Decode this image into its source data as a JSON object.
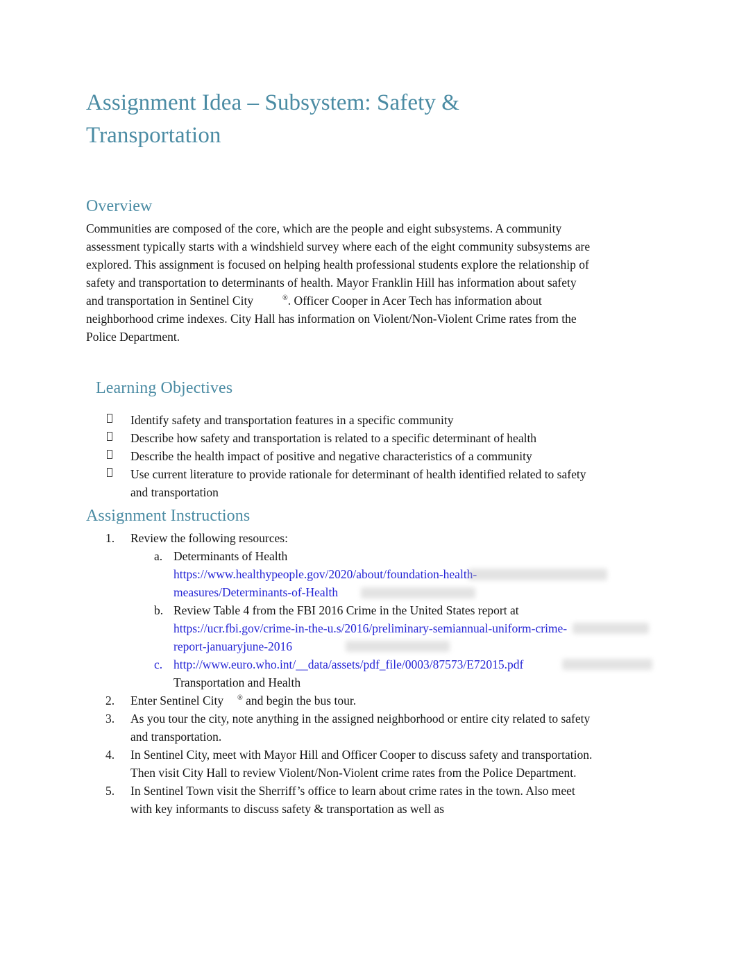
{
  "document": {
    "title": "Assignment Idea – Subsystem: Safety & Transportation",
    "colors": {
      "heading": "#4A8BA3",
      "link": "#2525D5",
      "body": "#151515",
      "page_background": "#ffffff"
    }
  },
  "overview": {
    "heading": "Overview",
    "paragraph_part1": "Communities are composed of the core, which are the people and eight subsystems. A community assessment typically starts with a windshield survey where each of the eight community subsystems are explored. This assignment is focused on helping health professional students explore the relationship of safety and transportation to determinants of health. Mayor Franklin Hill has information about safety and transportation in Sentinel City",
    "registered_mark": "®",
    "paragraph_part2": ". Officer Cooper in Acer Tech has information about neighborhood crime indexes. City Hall has information on Violent/Non-Violent Crime rates from the Police Department."
  },
  "learning_objectives": {
    "heading": "Learning Objectives",
    "bullet_glyph": "tofu-box-bullet",
    "items": [
      "Identify safety and transportation features in a specific community",
      "Describe how safety and transportation is related to a specific determinant of health",
      "Describe the health impact of positive and negative characteristics of a community",
      "Use current literature to provide rationale for determinant of health identified related to safety and transportation"
    ]
  },
  "assignment_instructions": {
    "heading": "Assignment Instructions",
    "items": [
      {
        "marker": "1.",
        "text": "Review the following resources:",
        "subitems": [
          {
            "marker": "a.",
            "text": "Determinants of Health",
            "link": "https://www.healthypeople.gov/2020/about/foundation-health-measures/Determinants-of-Health",
            "marker_is_link": false
          },
          {
            "marker": "b.",
            "text": "Review Table 4 from the FBI 2016 Crime in the United States report at",
            "link": "https://ucr.fbi.gov/crime-in-the-u.s/2016/preliminary-semiannual-uniform-crime-report-januaryjune-2016",
            "marker_is_link": false
          },
          {
            "marker": "c.",
            "link": "http://www.euro.who.int/__data/assets/pdf_file/0003/87573/E72015.pdf",
            "text_after": "Transportation and Health",
            "marker_is_link": true
          }
        ]
      },
      {
        "marker": "2.",
        "text_before_mark": "Enter Sentinel City",
        "registered_mark": "®",
        "text_after_mark": "and begin the bus tour."
      },
      {
        "marker": "3.",
        "text": "As you tour the city, note anything in the assigned neighborhood or entire city related to safety and transportation."
      },
      {
        "marker": "4.",
        "text": "In Sentinel City, meet with Mayor Hill and Officer Cooper to discuss safety and transportation. Then visit City Hall to review Violent/Non-Violent crime rates from the Police Department."
      },
      {
        "marker": "5.",
        "text": "In Sentinel Town visit the Sherriff’s office to learn about crime rates in the town. Also meet with key informants to discuss safety & transportation as well as"
      }
    ]
  }
}
